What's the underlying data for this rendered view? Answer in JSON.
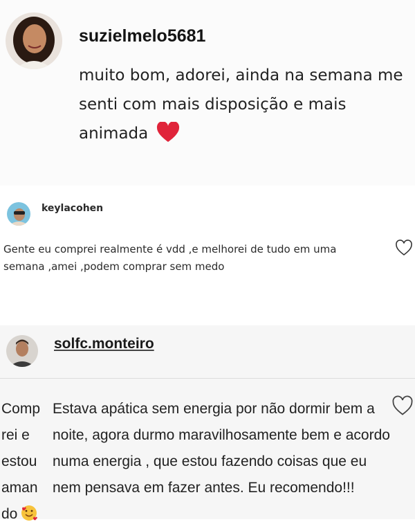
{
  "comments": [
    {
      "username": "suzielmelo5681",
      "text": "muito bom, adorei, ainda na semana me senti com mais disposição e mais animada",
      "emoji": "red-heart-icon"
    },
    {
      "username": "keylacohen",
      "text": "Gente eu comprei realmente é vdd ,e melhorei de tudo em uma semana ,amei ,podem comprar sem medo",
      "like_icon": "heart-outline-icon"
    },
    {
      "username": "solfc.monteiro",
      "side_text": [
        "Comp",
        "rei e",
        "estou",
        "aman",
        "do"
      ],
      "side_emoji": "smiling-face-with-hearts-icon",
      "text": "Estava apática sem energia por não dormir bem a noite, agora durmo maravilhosamente bem e acordo numa energia , que estou fazendo coisas que eu nem pensava em fazer antes. Eu recomendo!!!",
      "like_icon": "heart-outline-icon"
    }
  ],
  "colors": {
    "heart_red": "#e0243a",
    "text": "#222222",
    "divider": "#d0d0d0"
  }
}
